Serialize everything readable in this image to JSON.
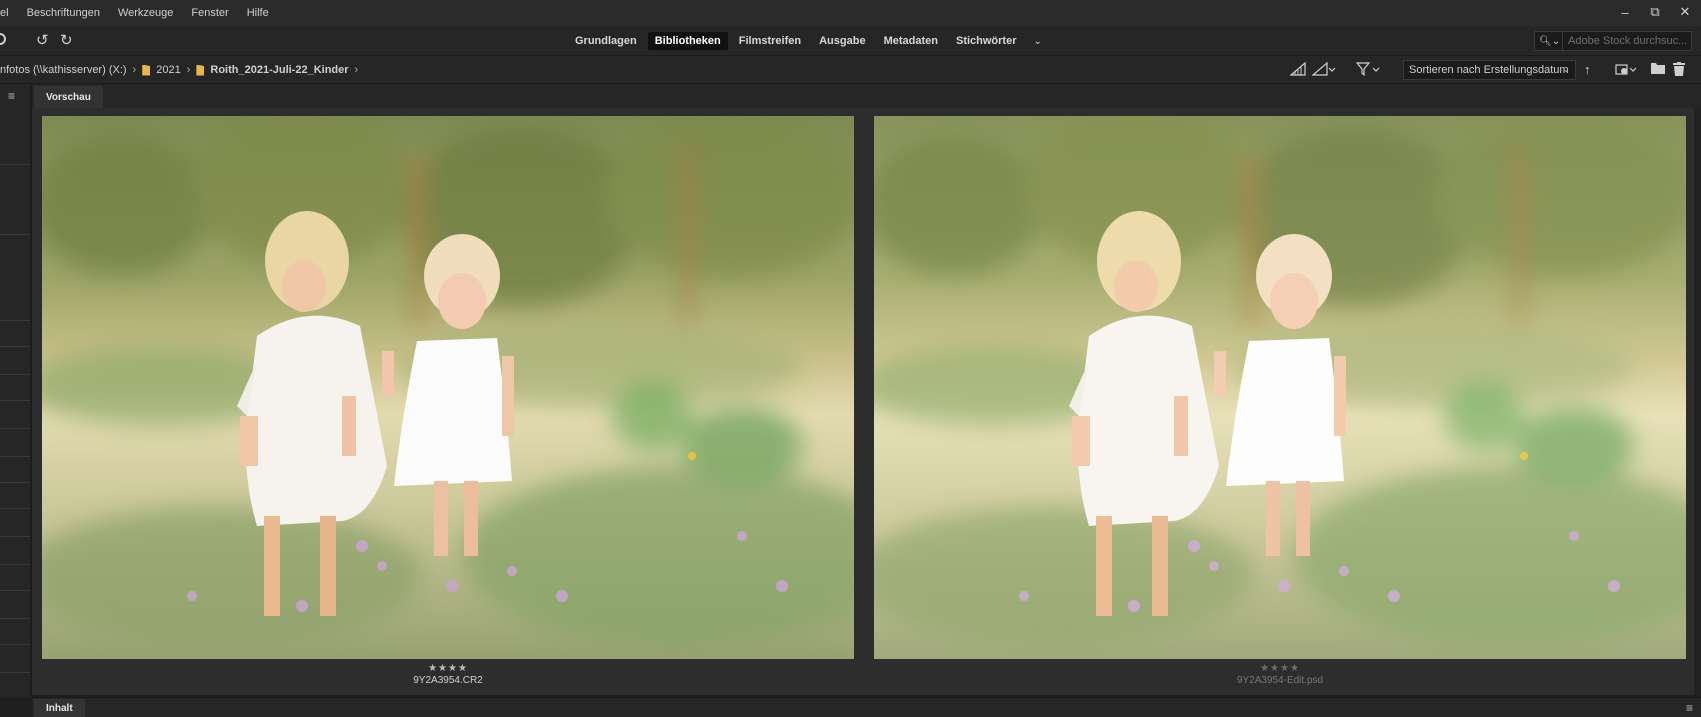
{
  "menu": [
    "el",
    "Beschriftungen",
    "Werkzeuge",
    "Fenster",
    "Hilfe"
  ],
  "window_controls": {
    "minimize": "–",
    "restore": "⧉",
    "close": "✕"
  },
  "toolbar": {
    "rotate_left_icon": "↺",
    "rotate_right_icon": "↻",
    "workspaces": [
      "Grundlagen",
      "Bibliotheken",
      "Filmstreifen",
      "Ausgabe",
      "Metadaten",
      "Stichwörter"
    ],
    "active_workspace": "Bibliotheken",
    "more": "⌄",
    "search_placeholder": "Adobe Stock durchsuc...",
    "search_icon": "🔍︎⌄"
  },
  "path": {
    "crumbs": [
      "nfotos (\\\\kathisserver) (X:)",
      "2021",
      "Roith_2021-Juli-22_Kinder"
    ]
  },
  "view": {
    "sort_label": "Sortieren nach Erstellungsdatum",
    "sort_chevron": "⌄",
    "ascending_icon": "↑"
  },
  "preview": {
    "tab_label": "Vorschau",
    "items": [
      {
        "filename": "9Y2A3954.CR2",
        "rating_stars": 4,
        "stars_text": "★★★★"
      },
      {
        "filename": "9Y2A3954-Edit.psd",
        "rating_stars": 4,
        "stars_text": "★★★★"
      }
    ]
  },
  "bottom": {
    "tab_label": "Inhalt"
  },
  "colors": {
    "accent_folder": "#e6b84a",
    "active_tab_bg": "#111111",
    "panel_bg": "#2d2d2d"
  }
}
